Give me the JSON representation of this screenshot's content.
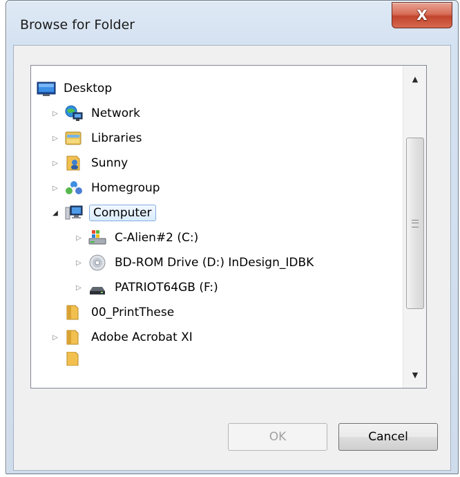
{
  "window": {
    "title": "Browse for Folder",
    "close_glyph": "X"
  },
  "tree": {
    "items": [
      {
        "label": "Desktop",
        "icon": "desktop-icon",
        "level": 0,
        "expander": "none"
      },
      {
        "label": "Network",
        "icon": "network-icon",
        "level": 1,
        "expander": "collapsed"
      },
      {
        "label": "Libraries",
        "icon": "libraries-icon",
        "level": 1,
        "expander": "collapsed"
      },
      {
        "label": "Sunny",
        "icon": "user-folder-icon",
        "level": 1,
        "expander": "collapsed"
      },
      {
        "label": "Homegroup",
        "icon": "homegroup-icon",
        "level": 1,
        "expander": "collapsed"
      },
      {
        "label": "Computer",
        "icon": "computer-icon",
        "level": 1,
        "expander": "expanded",
        "selected": true
      },
      {
        "label": "C-Alien#2 (C:)",
        "icon": "system-drive-icon",
        "level": 2,
        "expander": "collapsed"
      },
      {
        "label": "BD-ROM Drive (D:) InDesign_IDBK",
        "icon": "optical-drive-icon",
        "level": 2,
        "expander": "collapsed"
      },
      {
        "label": "PATRIOT64GB (F:)",
        "icon": "usb-drive-icon",
        "level": 2,
        "expander": "collapsed"
      },
      {
        "label": "00_PrintThese",
        "icon": "folder-icon",
        "level": 1,
        "expander": "none"
      },
      {
        "label": "Adobe Acrobat XI",
        "icon": "folder-icon",
        "level": 1,
        "expander": "collapsed"
      }
    ]
  },
  "buttons": {
    "ok_label": "OK",
    "cancel_label": "Cancel"
  },
  "colors": {
    "selection_border": "#84acdd",
    "close_button": "#c2442d"
  }
}
